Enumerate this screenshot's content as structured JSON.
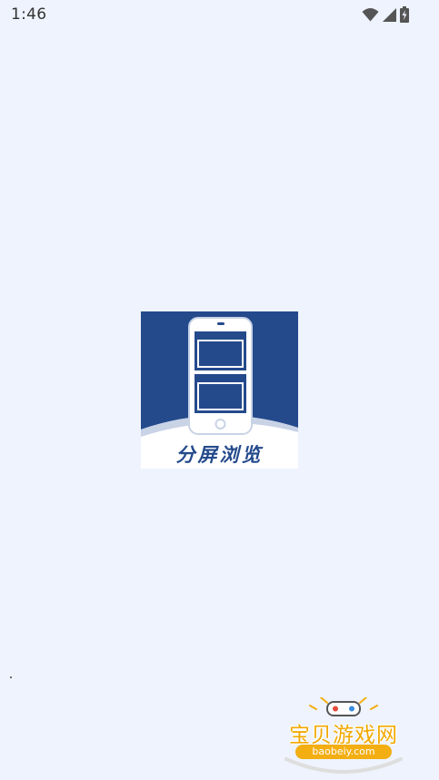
{
  "status_bar": {
    "time": "1:46",
    "icons": [
      "wifi-icon",
      "cell-signal-icon",
      "battery-charging-icon"
    ]
  },
  "splash": {
    "logo_text": "分屏浏览",
    "brand_color": "#244a8c"
  },
  "watermark": {
    "site_name": "宝贝游戏网",
    "site_url": "baobeiy.com",
    "accent_color": "#f2a800"
  }
}
